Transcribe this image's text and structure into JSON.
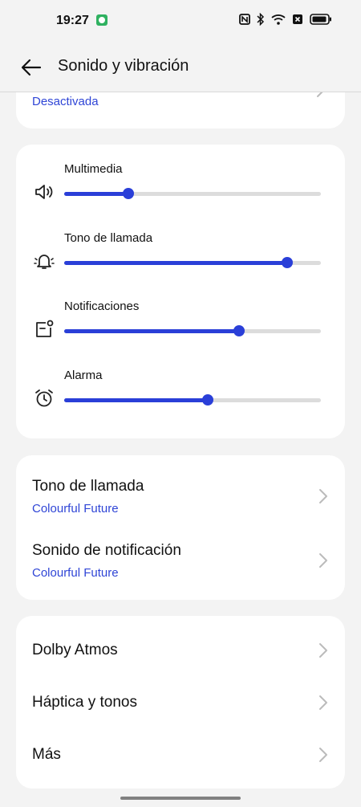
{
  "status_bar": {
    "time": "19:27",
    "icons": [
      "notification-app-icon",
      "nfc-icon",
      "bluetooth-icon",
      "wifi-icon",
      "no-sim-icon",
      "battery-icon"
    ]
  },
  "header": {
    "title": "Sonido y vibración",
    "back_icon": "arrow-left-icon"
  },
  "top_item": {
    "subtitle": "Desactivada"
  },
  "volume": {
    "accent": "#2a3fd8",
    "sliders": [
      {
        "label": "Multimedia",
        "icon": "speaker-icon",
        "level": 0.25
      },
      {
        "label": "Tono de llamada",
        "icon": "ringer-bell-icon",
        "level": 0.87
      },
      {
        "label": "Notificaciones",
        "icon": "notification-icon",
        "level": 0.68
      },
      {
        "label": "Alarma",
        "icon": "alarm-clock-icon",
        "level": 0.56
      }
    ]
  },
  "tones": {
    "items": [
      {
        "title": "Tono de llamada",
        "subtitle": "Colourful Future"
      },
      {
        "title": "Sonido de notificación",
        "subtitle": "Colourful Future"
      }
    ]
  },
  "misc": {
    "items": [
      {
        "title": "Dolby Atmos"
      },
      {
        "title": "Háptica y tonos"
      },
      {
        "title": "Más"
      }
    ]
  }
}
